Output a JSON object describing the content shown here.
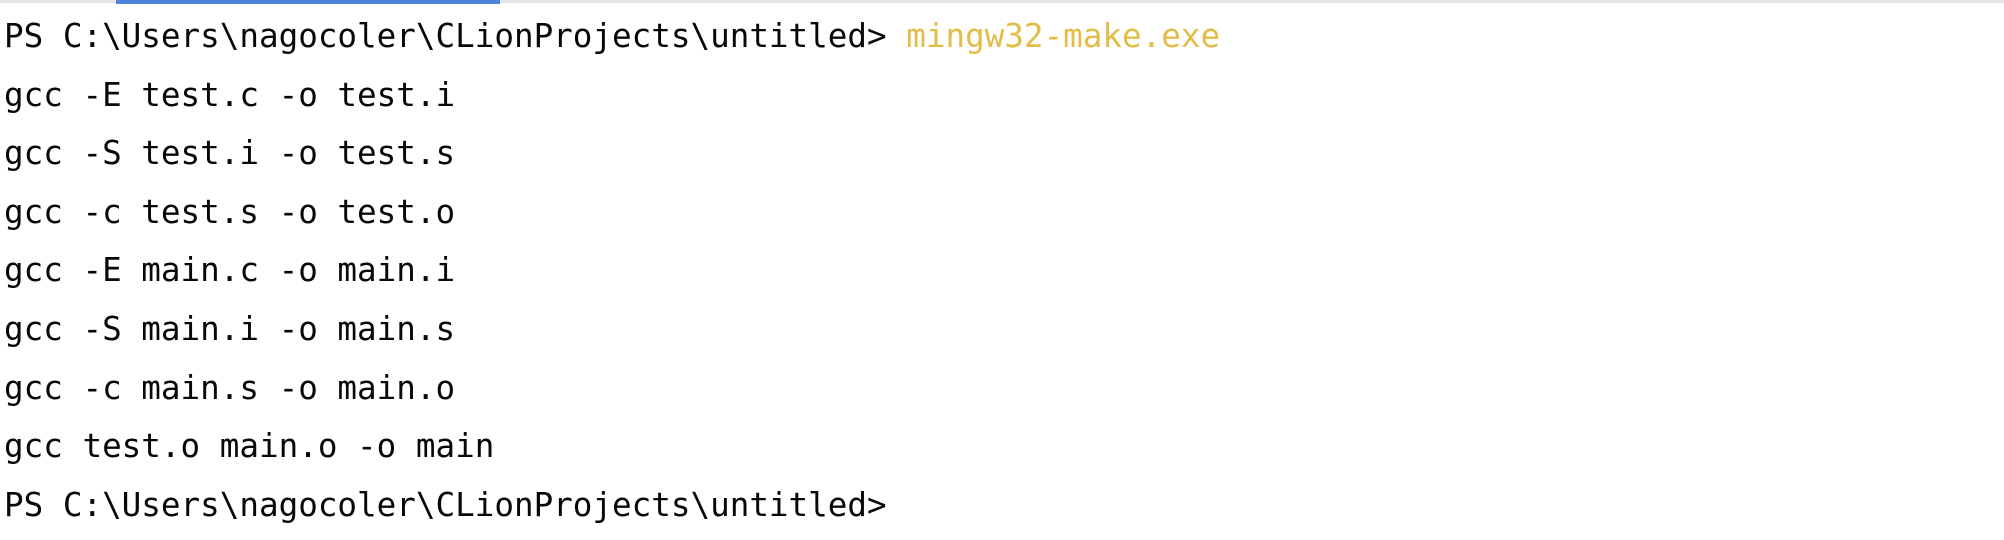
{
  "terminal": {
    "prompt": "PS C:\\Users\\nagocoler\\CLionProjects\\untitled> ",
    "command": "mingw32-make.exe",
    "output": [
      "gcc -E test.c -o test.i",
      "gcc -S test.i -o test.s",
      "gcc -c test.s -o test.o",
      "gcc -E main.c -o main.i",
      "gcc -S main.i -o main.s",
      "gcc -c main.s -o main.o",
      "gcc test.o main.o -o main"
    ],
    "final_prompt": "PS C:\\Users\\nagocoler\\CLionProjects\\untitled>"
  },
  "colors": {
    "text": "#080808",
    "command": "#e2bd47",
    "tab_indicator": "#4d83dd",
    "background": "#ffffff"
  }
}
